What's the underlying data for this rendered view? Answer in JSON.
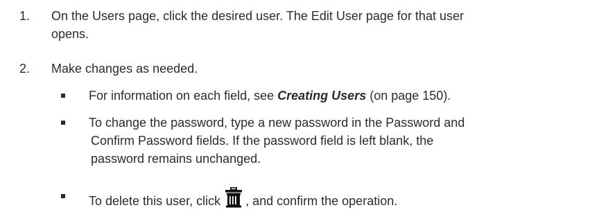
{
  "steps": [
    {
      "number": "1.",
      "line1": "On the Users page, click the desired user. The Edit User page for that user",
      "line2": "opens."
    },
    {
      "number": "2.",
      "line1": "Make changes as needed."
    }
  ],
  "bullets": {
    "b1": {
      "before": "For information on each field, see ",
      "link": "Creating Users",
      "after": " (on page 150)."
    },
    "b2": {
      "line1": "To change the password, type a new password in the Password and",
      "line2": "Confirm Password fields. If the password field is left blank, the",
      "line3": "password remains unchanged."
    },
    "b3": {
      "before": "To delete this user, click",
      "icon": "trash-icon",
      "after": ", and confirm the operation."
    }
  }
}
